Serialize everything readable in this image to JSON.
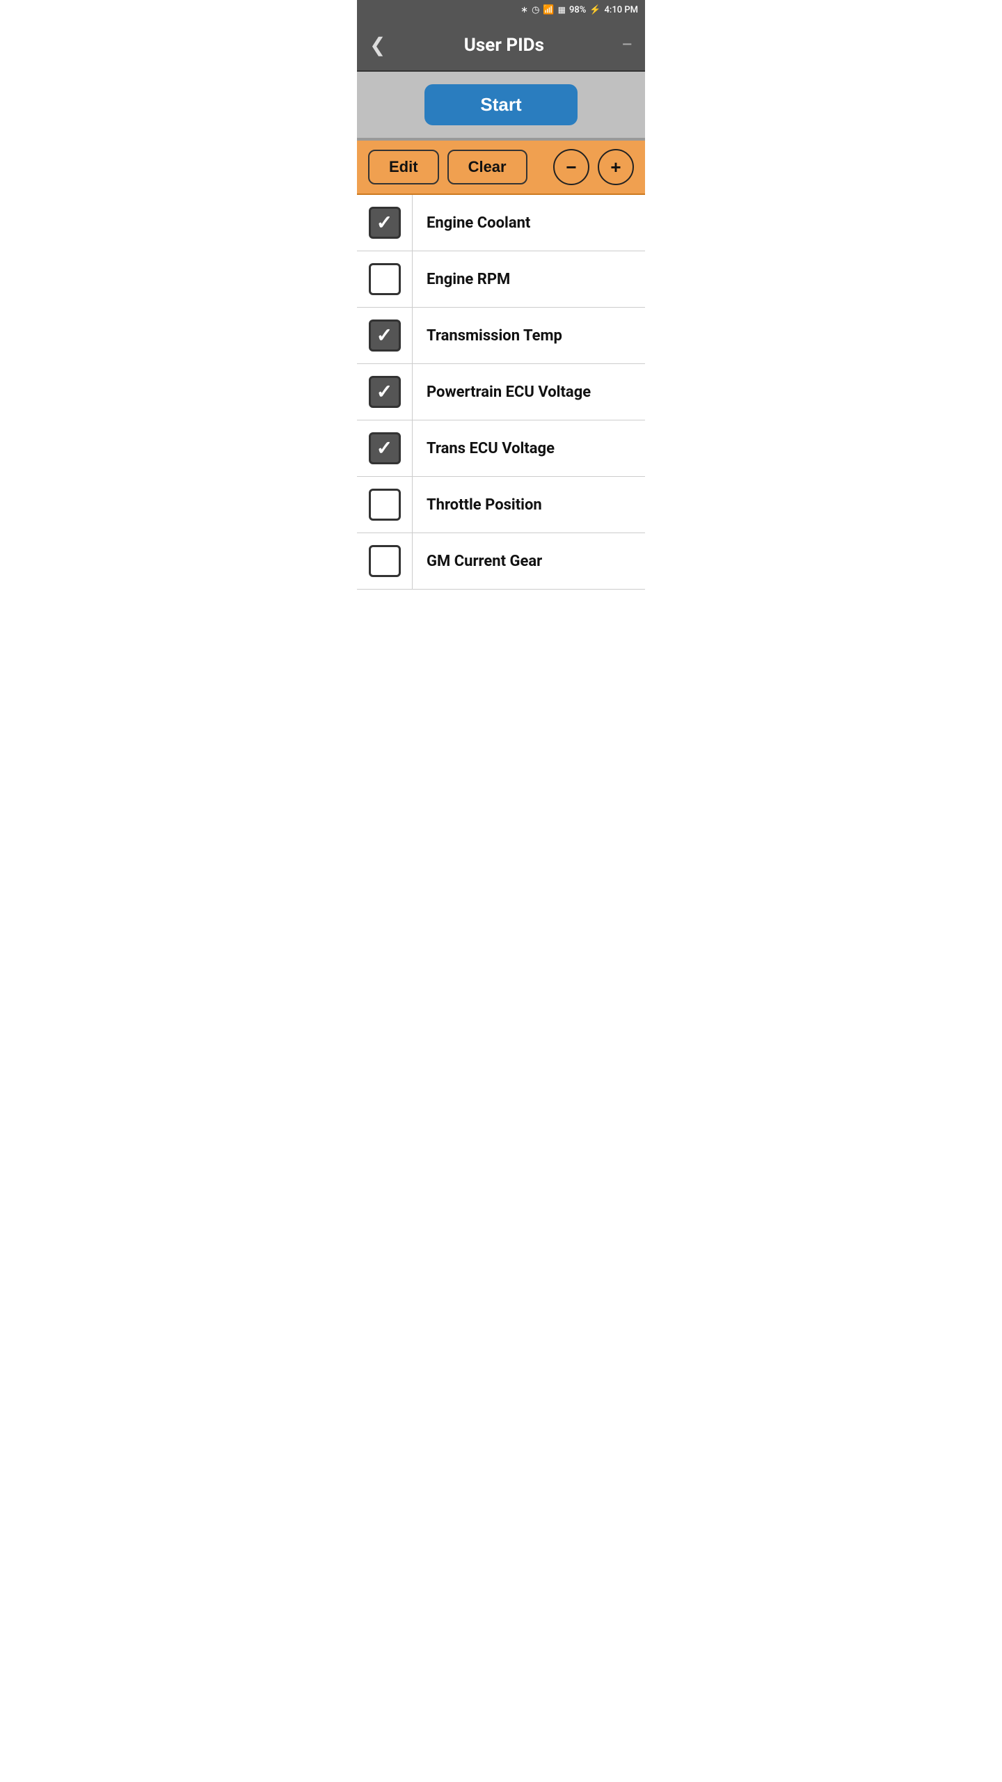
{
  "statusBar": {
    "battery": "98%",
    "time": "4:10 PM",
    "icons": [
      "bluetooth",
      "alarm",
      "wifi",
      "signal-bars"
    ]
  },
  "header": {
    "backLabel": "‹",
    "title": "User PIDs",
    "menuIcon": "—"
  },
  "startButton": {
    "label": "Start"
  },
  "toolbar": {
    "editLabel": "Edit",
    "clearLabel": "Clear",
    "minusLabel": "−",
    "plusLabel": "+"
  },
  "pidList": [
    {
      "label": "Engine Coolant",
      "checked": true
    },
    {
      "label": "Engine RPM",
      "checked": false
    },
    {
      "label": "Transmission Temp",
      "checked": true
    },
    {
      "label": "Powertrain ECU Voltage",
      "checked": true
    },
    {
      "label": "Trans ECU Voltage",
      "checked": true
    },
    {
      "label": "Throttle Position",
      "checked": false
    },
    {
      "label": "GM Current Gear",
      "checked": false
    }
  ]
}
